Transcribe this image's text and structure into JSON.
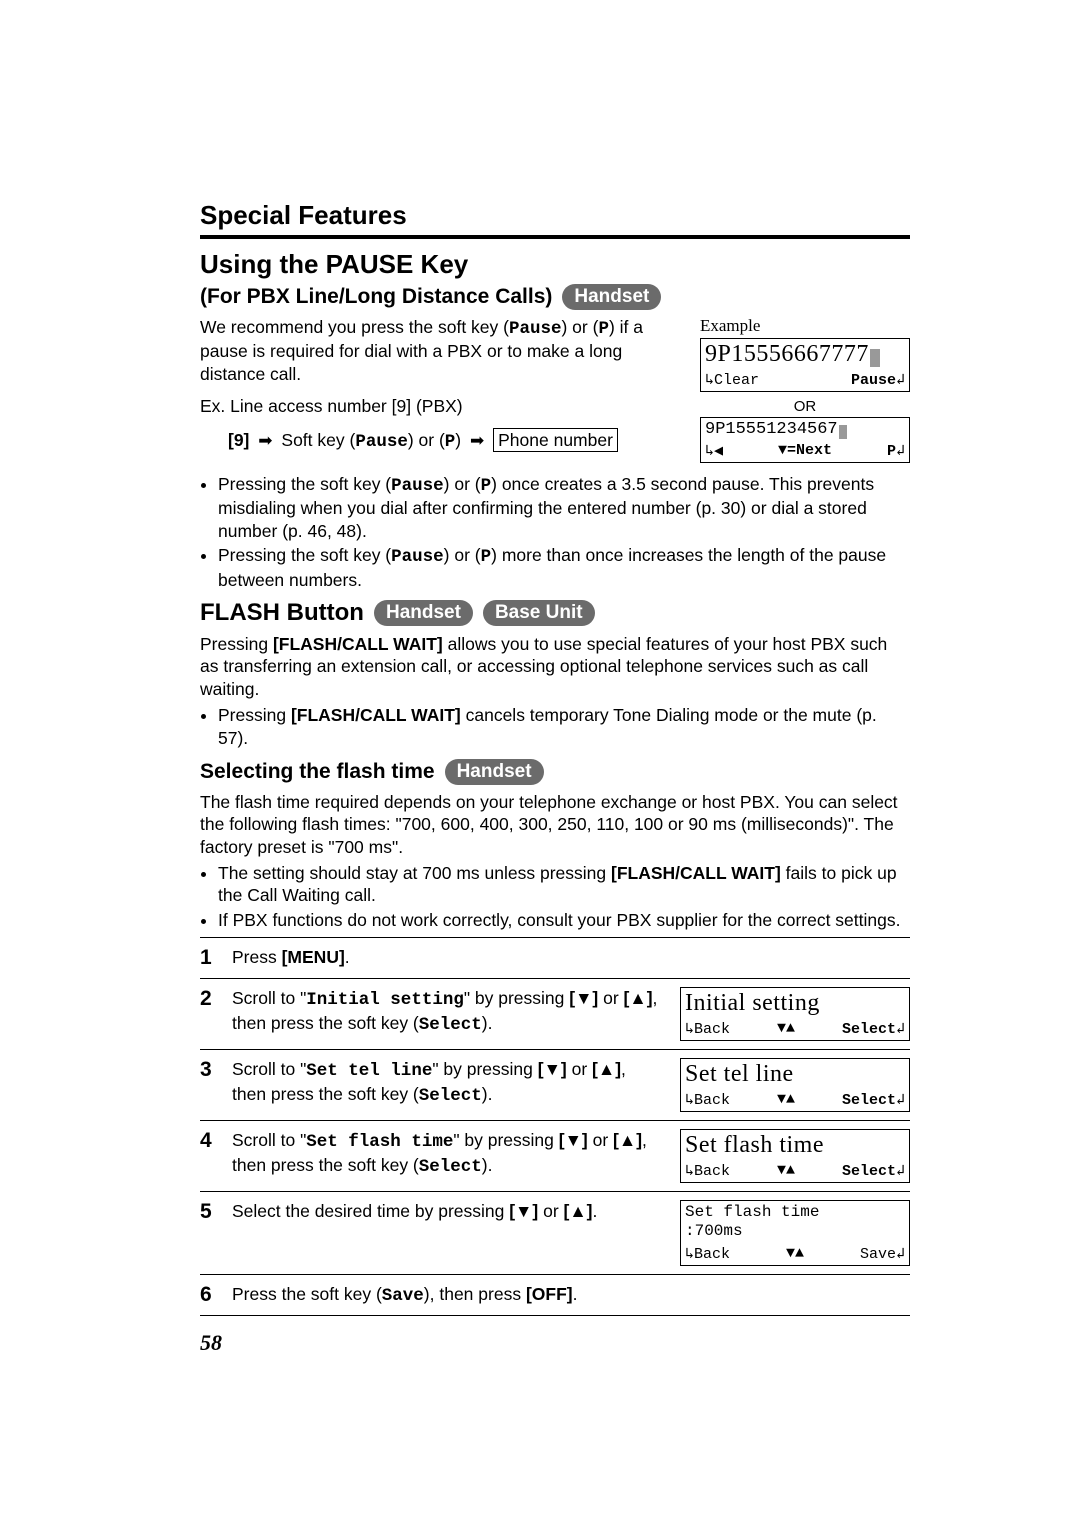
{
  "section_title": "Special Features",
  "pause": {
    "heading": "Using the PAUSE Key",
    "sub_heading": "(For PBX Line/Long Distance Calls)",
    "pill_handset": "Handset",
    "intro": "We recommend you press the soft key (",
    "pause_label": "Pause",
    "intro2": ") or (",
    "p_label": "P",
    "intro3": ") if a pause is required for dial with a PBX or to make a long distance call.",
    "ex_line": "Ex.  Line access number [9] (PBX)",
    "seq_9": "[9]",
    "seq_soft": "Soft key (",
    "seq_or": ") or (",
    "seq_close": ")",
    "seq_phone": "Phone number",
    "bullet1a": "Pressing the soft key (",
    "bullet1b": ") or (",
    "bullet1c": ") once creates a 3.5 second pause. This prevents misdialing when you dial after confirming the entered number (p. 30) or dial a stored number (p. 46, 48).",
    "bullet2a": "Pressing the soft key (",
    "bullet2b": ") or (",
    "bullet2c": ") more than once increases the length of the pause between numbers.",
    "example_label": "Example",
    "lcd1_main": "9P15556667777",
    "lcd1_left": "Clear",
    "lcd1_right": "Pause",
    "or": "OR",
    "lcd2_main": "9P15551234567",
    "lcd2_mid": "▼=Next",
    "lcd2_right": "P"
  },
  "flash": {
    "heading": "FLASH Button",
    "pill_handset": "Handset",
    "pill_base": "Base Unit",
    "para1a": "Pressing ",
    "fcw": "[FLASH/CALL WAIT]",
    "para1b": " allows you to use special features of your host PBX such as transferring an extension call, or accessing optional telephone services such as call waiting.",
    "bullet1a": "Pressing ",
    "bullet1b": " cancels temporary Tone Dialing mode or the mute (p. 57)."
  },
  "selecting": {
    "heading": "Selecting the flash time",
    "pill_handset": "Handset",
    "para1": "The flash time required depends on your telephone exchange or host PBX. You can select the following flash times: \"700, 600, 400, 300, 250, 110, 100 or 90 ms (milliseconds)\". The factory preset is \"700 ms\".",
    "bullet1a": "The setting should stay at 700 ms unless pressing ",
    "bullet1b": " fails to pick up the Call Waiting call.",
    "bullet2": "If PBX functions do not work correctly, consult your PBX supplier for the correct settings."
  },
  "steps": {
    "s1": {
      "text_a": "Press ",
      "menu": "[MENU]",
      "text_b": "."
    },
    "s2": {
      "text_a": "Scroll to \"",
      "code": "Initial setting",
      "text_b": "\" by pressing ",
      "down": "[▼]",
      "text_c": " or ",
      "up": "[▲]",
      "text_d": ", then press the soft key (",
      "select": "Select",
      "text_e": ").",
      "lcd_main": "Initial setting",
      "lcd_left": "Back",
      "lcd_mid": "▼▲",
      "lcd_right": "Select"
    },
    "s3": {
      "text_a": "Scroll to \"",
      "code": "Set tel line",
      "text_b": "\" by pressing ",
      "down": "[▼]",
      "text_c": " or ",
      "up": "[▲]",
      "text_d": ", then press the soft key (",
      "select": "Select",
      "text_e": ").",
      "lcd_main": "Set tel line",
      "lcd_left": "Back",
      "lcd_mid": "▼▲",
      "lcd_right": "Select"
    },
    "s4": {
      "text_a": "Scroll to \"",
      "code": "Set flash time",
      "text_b": "\" by pressing ",
      "down": "[▼]",
      "text_c": " or ",
      "up": "[▲]",
      "text_d": ", then press the soft key (",
      "select": "Select",
      "text_e": ").",
      "lcd_main": "Set flash time",
      "lcd_left": "Back",
      "lcd_mid": "▼▲",
      "lcd_right": "Select"
    },
    "s5": {
      "text_a": "Select the desired time by pressing ",
      "down": "[▼]",
      "text_b": " or ",
      "up": "[▲]",
      "text_c": ".",
      "lcd_line1": "Set flash time",
      "lcd_line2": ":700ms",
      "lcd_left": "Back",
      "lcd_mid": "▼▲",
      "lcd_right": "Save"
    },
    "s6": {
      "text_a": "Press the soft key (",
      "save": "Save",
      "text_b": "), then press ",
      "off": "[OFF]",
      "text_c": "."
    }
  },
  "page_number": "58"
}
